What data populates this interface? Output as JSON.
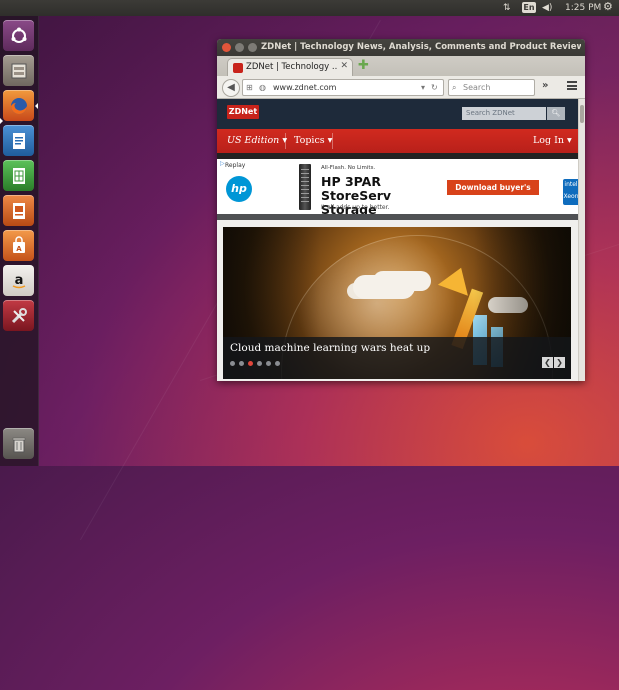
{
  "top_panel": {
    "keyboard_layout": "En",
    "clock": "1:25 PM"
  },
  "launcher": {
    "items": [
      {
        "name": "Ubuntu Dash",
        "icon": "ubuntu-logo-icon",
        "color": "#7a3b78"
      },
      {
        "name": "Files",
        "icon": "file-cabinet-icon",
        "color": "#8b8378"
      },
      {
        "name": "Firefox Web Browser",
        "icon": "firefox-icon",
        "color": "#e66a1b",
        "running": true
      },
      {
        "name": "LibreOffice Writer",
        "icon": "writer-document-icon",
        "color": "#2a6fb4"
      },
      {
        "name": "LibreOffice Calc",
        "icon": "calc-spreadsheet-icon",
        "color": "#3c9a3b"
      },
      {
        "name": "LibreOffice Impress",
        "icon": "impress-presentation-icon",
        "color": "#d0581e"
      },
      {
        "name": "Ubuntu Software",
        "icon": "shopping-bag-icon",
        "color": "#e06d1c"
      },
      {
        "name": "Amazon",
        "icon": "amazon-icon",
        "color": "#e9e6e1"
      },
      {
        "name": "System Settings",
        "icon": "settings-tools-icon",
        "color": "#9a1f2b"
      },
      {
        "name": "Trash",
        "icon": "trash-icon",
        "color": "#6d6a66"
      }
    ]
  },
  "window": {
    "title": "ZDNet | Technology News, Analysis, Comments and Product Reviews for IT Professionals - Mozilla Firefox",
    "tab_title": "ZDNet | Technology ...",
    "url": "www.zdnet.com",
    "search_placeholder": "Search"
  },
  "page": {
    "logo": "ZDNet",
    "search_placeholder": "Search ZDNet",
    "nav": {
      "edition": "US Edition",
      "topics": "Topics",
      "login": "Log In"
    },
    "ad": {
      "replay": "Replay",
      "brand": "hp",
      "flash": "All-Flash. No Limits.",
      "headline": "HP 3PAR StoreServ Storage",
      "tagline": "It all adds up to better.",
      "cta": "Download buyer's guide",
      "side_brand": "intel Xeon"
    },
    "hero": {
      "caption": "Cloud machine learning wars heat up",
      "dots_total": 6,
      "active_dot": 3
    }
  },
  "colors": {
    "zdnet_red": "#c8231b",
    "zdnet_header": "#1e2a3a",
    "ad_cta": "#d8421a",
    "hp_blue": "#0096d6"
  }
}
